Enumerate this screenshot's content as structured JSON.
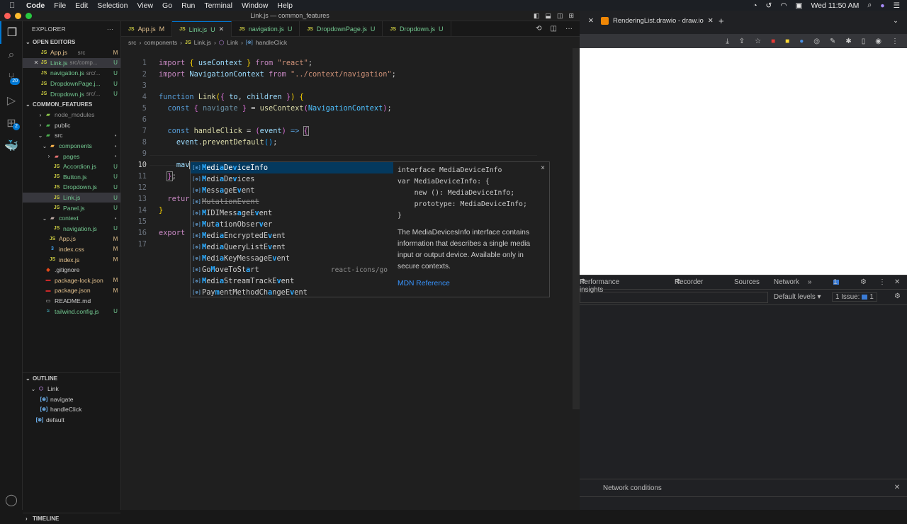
{
  "menubar": {
    "apple": "",
    "items": [
      "Code",
      "File",
      "Edit",
      "Selection",
      "View",
      "Go",
      "Run",
      "Terminal",
      "Window",
      "Help"
    ],
    "clock": "Wed 11:50 AM"
  },
  "window": {
    "title": "Link.js — common_features"
  },
  "activity_bar": {
    "source_control_badge": "20",
    "extensions_badge": "2"
  },
  "explorer": {
    "title": "EXPLORER",
    "more": "···",
    "open_editors": {
      "label": "OPEN EDITORS",
      "items": [
        {
          "name": "App.js",
          "path": "src",
          "status": "M",
          "close": ""
        },
        {
          "name": "Link.js",
          "path": "src/comp...",
          "status": "U",
          "close": "✕"
        },
        {
          "name": "navigation.js",
          "path": "src/...",
          "status": "U",
          "close": ""
        },
        {
          "name": "DropdownPage.j...",
          "path": "",
          "status": "U",
          "close": ""
        },
        {
          "name": "Dropdown.js",
          "path": "src/...",
          "status": "U",
          "close": ""
        }
      ]
    },
    "project": {
      "label": "COMMON_FEATURES",
      "items": [
        {
          "name": "node_modules",
          "type": "folder",
          "status": ""
        },
        {
          "name": "public",
          "type": "folder",
          "status": ""
        },
        {
          "name": "src",
          "type": "folder",
          "status": "•"
        },
        {
          "name": "components",
          "type": "folder",
          "status": "•"
        },
        {
          "name": "pages",
          "type": "folder",
          "status": "•"
        },
        {
          "name": "Accordion.js",
          "type": "js",
          "status": "U"
        },
        {
          "name": "Button.js",
          "type": "js",
          "status": "U"
        },
        {
          "name": "Dropdown.js",
          "type": "js",
          "status": "U"
        },
        {
          "name": "Link.js",
          "type": "js",
          "status": "U"
        },
        {
          "name": "Panel.js",
          "type": "js",
          "status": "U"
        },
        {
          "name": "context",
          "type": "folder",
          "status": "•"
        },
        {
          "name": "navigation.js",
          "type": "js",
          "status": "U"
        },
        {
          "name": "App.js",
          "type": "js",
          "status": "M"
        },
        {
          "name": "index.css",
          "type": "css",
          "status": "M"
        },
        {
          "name": "index.js",
          "type": "js",
          "status": "M"
        },
        {
          "name": ".gitignore",
          "type": "git",
          "status": ""
        },
        {
          "name": "package-lock.json",
          "type": "json",
          "status": "M"
        },
        {
          "name": "package.json",
          "type": "json",
          "status": "M"
        },
        {
          "name": "README.md",
          "type": "md",
          "status": ""
        },
        {
          "name": "tailwind.config.js",
          "type": "tw",
          "status": "U"
        }
      ]
    },
    "outline": {
      "label": "OUTLINE",
      "items": [
        {
          "name": "Link",
          "kind": "component"
        },
        {
          "name": "navigate",
          "kind": "variable"
        },
        {
          "name": "handleClick",
          "kind": "variable"
        },
        {
          "name": "default",
          "kind": "variable"
        }
      ]
    },
    "timeline": {
      "label": "TIMELINE"
    }
  },
  "editor": {
    "tabs": [
      {
        "name": "App.js",
        "status": "M"
      },
      {
        "name": "Link.js",
        "status": "U",
        "close": "✕"
      },
      {
        "name": "navigation.js",
        "status": "U"
      },
      {
        "name": "DropdownPage.js",
        "status": "U"
      },
      {
        "name": "Dropdown.js",
        "status": "U"
      }
    ],
    "breadcrumb": [
      "src",
      "components",
      "Link.js",
      "Link",
      "handleClick"
    ],
    "current_line": 10,
    "line_numbers": [
      "1",
      "2",
      "3",
      "4",
      "5",
      "6",
      "7",
      "8",
      "9",
      "10",
      "11",
      "12",
      "13",
      "14",
      "15",
      "16",
      "17"
    ],
    "typed_text": "mav",
    "suggestions": [
      {
        "label": "MediaDeviceInfo",
        "detail": "",
        "deprecated": false
      },
      {
        "label": "MediaDevices",
        "detail": "",
        "deprecated": false
      },
      {
        "label": "MessageEvent",
        "detail": "",
        "deprecated": false
      },
      {
        "label": "MutationEvent",
        "detail": "",
        "deprecated": true
      },
      {
        "label": "MIDIMessageEvent",
        "detail": "",
        "deprecated": false
      },
      {
        "label": "MutationObserver",
        "detail": "",
        "deprecated": false
      },
      {
        "label": "MediaEncryptedEvent",
        "detail": "",
        "deprecated": false
      },
      {
        "label": "MediaQueryListEvent",
        "detail": "",
        "deprecated": false
      },
      {
        "label": "MediaKeyMessageEvent",
        "detail": "",
        "deprecated": false
      },
      {
        "label": "GoMoveToStart",
        "detail": "react-icons/go",
        "deprecated": false
      },
      {
        "label": "MediaStreamTrackEvent",
        "detail": "",
        "deprecated": false
      },
      {
        "label": "PaymentMethodChangeEvent",
        "detail": "",
        "deprecated": false
      }
    ],
    "docs": {
      "signature": "interface MediaDeviceInfo\nvar MediaDeviceInfo: {\n    new (): MediaDeviceInfo;\n    prototype: MediaDeviceInfo;\n}",
      "description": "The MediaDevicesInfo interface contains information that describes a single media input or output device. Available only in secure contexts.",
      "link": "MDN Reference",
      "close": "×"
    }
  },
  "browser": {
    "tab_title": "RenderingList.drawio - draw.io",
    "devtools": {
      "tabs": [
        "Performance insights",
        "Recorder",
        "Sources",
        "Network"
      ],
      "more": "»",
      "issues_badge": "1",
      "default_levels": "Default levels ▾",
      "issues_label": "1 Issue:",
      "issues_count": "1",
      "drawer_tab": "Network conditions"
    }
  }
}
